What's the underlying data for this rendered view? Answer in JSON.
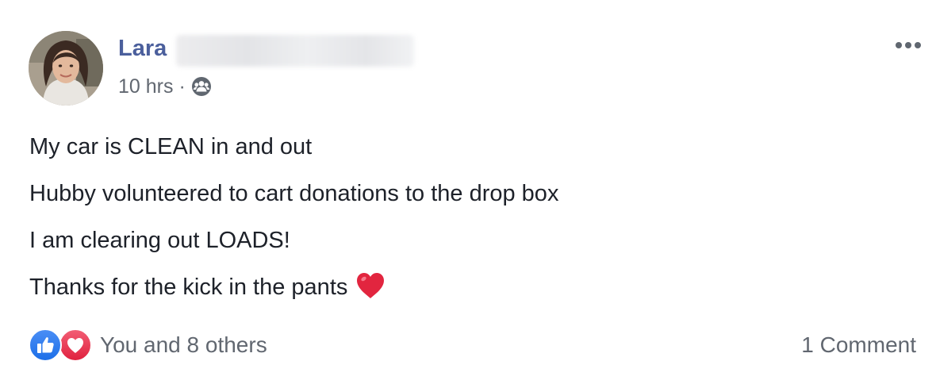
{
  "post": {
    "author": {
      "name": "Lara",
      "avatar_icon": "profile-photo"
    },
    "timestamp": "10 hrs",
    "separator": "·",
    "audience_icon": "friends-group-icon",
    "more_icon": "ellipsis-icon",
    "lines": [
      "My car is CLEAN in and out",
      "Hubby volunteered to cart donations to the drop box",
      "I am clearing out LOADS!",
      "Thanks for the kick in the pants"
    ],
    "trailing_emoji": "red-heart-icon",
    "reactions": {
      "icons": [
        "like-icon",
        "love-icon"
      ],
      "summary": "You and 8 others"
    },
    "comments_label": "1 Comment"
  },
  "colors": {
    "name": "#4b5f9c",
    "text": "#1d2129",
    "meta": "#616770",
    "like_blue": "#1d6fe8",
    "love_red": "#e0223f",
    "heart": "#e2253f"
  }
}
